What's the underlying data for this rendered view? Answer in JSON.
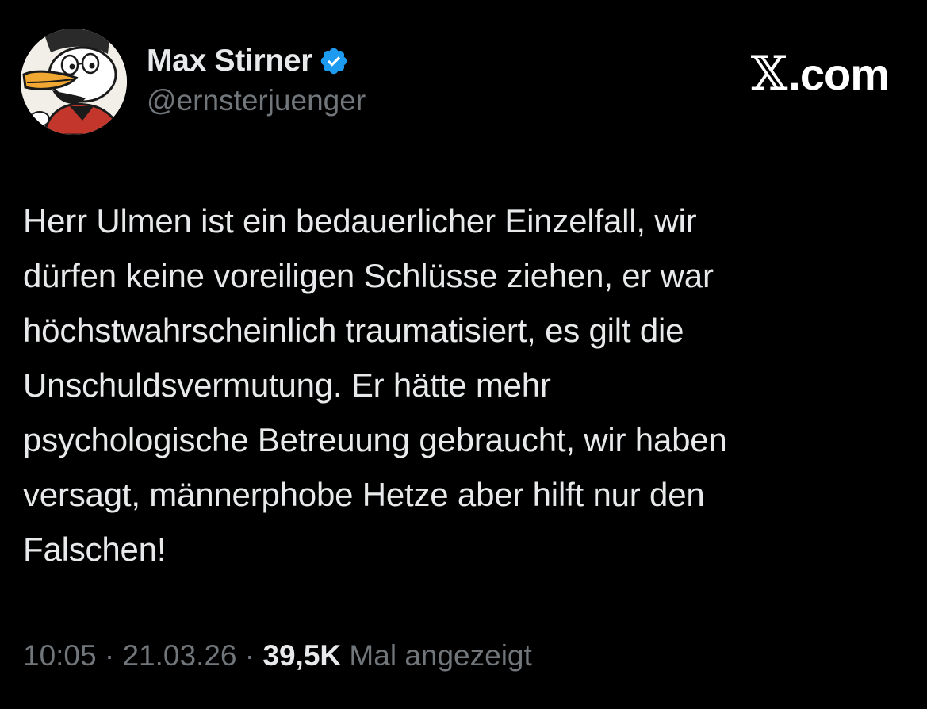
{
  "author": {
    "display_name": "Max Stirner",
    "handle": "@ernsterjuenger",
    "verified": true,
    "verified_color": "#1d9bf0",
    "avatar_icon": "duck-cartoon-avatar"
  },
  "brand": {
    "label": ".com",
    "icon": "x-logo-icon"
  },
  "tweet": {
    "text": "Herr Ulmen ist ein bedauerlicher Einzelfall, wir\ndürfen keine voreiligen Schlüsse ziehen, er war\nhöchstwahrscheinlich traumatisiert, es gilt die\nUnschuldsvermutung. Er hätte mehr\npsychologische Betreuung gebraucht, wir haben\nversagt, männerphobe Hetze aber hilft nur den\nFalschen!"
  },
  "meta": {
    "time": "10:05",
    "separator": " · ",
    "date": "21.03.26",
    "views_count": "39,5K",
    "views_label": "Mal angezeigt"
  },
  "colors": {
    "background": "#000000",
    "text_primary": "#e7e9ea",
    "text_secondary": "#71767b"
  }
}
